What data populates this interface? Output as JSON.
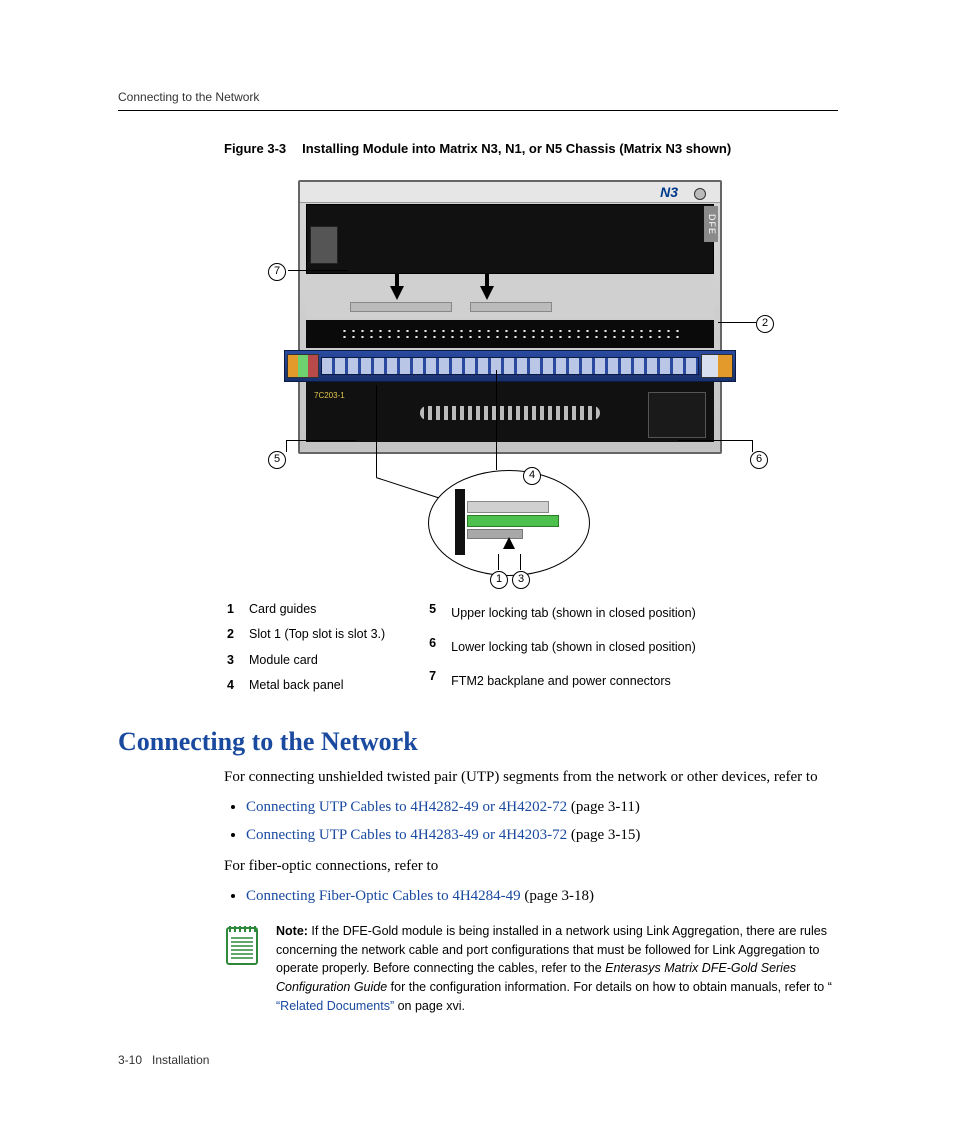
{
  "header": {
    "running": "Connecting to the Network"
  },
  "figure": {
    "label": "Figure 3-3",
    "title": "Installing Module into Matrix N3, N1, or N5 Chassis (Matrix N3 shown)",
    "brand": "N3",
    "dfe": "DFE",
    "yc": "7C203-1"
  },
  "callouts": {
    "c1": "1",
    "c2": "2",
    "c3": "3",
    "c4": "4",
    "c5": "5",
    "c6": "6",
    "c7": "7"
  },
  "legend": {
    "left": [
      {
        "n": "1",
        "t": "Card guides"
      },
      {
        "n": "2",
        "t": "Slot 1 (Top slot is slot 3.)"
      },
      {
        "n": "3",
        "t": "Module card"
      },
      {
        "n": "4",
        "t": "Metal back panel"
      }
    ],
    "right": [
      {
        "n": "5",
        "t": "Upper locking tab (shown in closed position)"
      },
      {
        "n": "6",
        "t": "Lower locking tab (shown in closed position)"
      },
      {
        "n": "7",
        "t": "FTM2 backplane and power connectors"
      }
    ]
  },
  "section": {
    "title": "Connecting to the Network"
  },
  "para1": "For connecting unshielded twisted pair (UTP) segments from the network or other devices, refer to",
  "bul1": {
    "link": "Connecting UTP Cables to 4H4282-49 or 4H4202-72",
    "page": " (page 3-11)"
  },
  "bul2": {
    "link": "Connecting UTP Cables to 4H4283-49 or 4H4203-72",
    "page": " (page 3-15)"
  },
  "para2": "For fiber-optic connections, refer to",
  "bul3": {
    "link": "Connecting Fiber-Optic Cables to 4H4284-49",
    "page": " (page 3-18)"
  },
  "note": {
    "lead": "Note:",
    "t1": " If the DFE-Gold module is being installed in a network using Link Aggregation, there are rules concerning the network cable and port configurations that must be followed for Link Aggregation to operate properly. Before connecting the cables, refer to the ",
    "em": "Enterasys Matrix DFE-Gold Series Configuration Guide",
    "t2": " for the configuration information. For details on how to obtain manuals, refer to “ ",
    "link": "“Related Documents”",
    "t3": " on page xvi."
  },
  "footer": {
    "pg": "3-10",
    "chap": "Installation"
  }
}
